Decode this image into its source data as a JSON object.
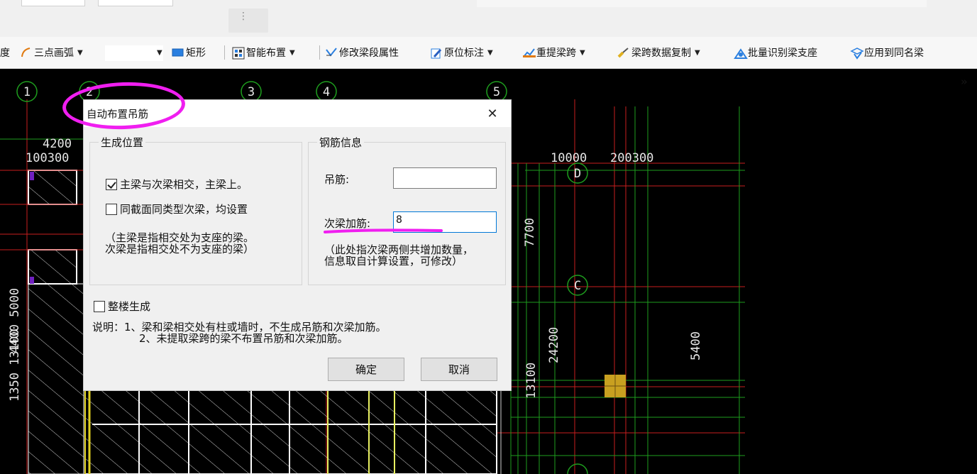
{
  "toolbar": {
    "cut_left_label": "度",
    "arc_label": "三点画弧",
    "rect_label": "矩形",
    "smart_place_label": "智能布置",
    "modify_span_label": "修改梁段属性",
    "inplace_label": "原位标注",
    "reextract_label": "重提梁跨",
    "copy_span_label": "梁跨数据复制",
    "batch_identify_label": "批量识别梁支座",
    "apply_same_label": "应用到同名梁",
    "more_label": "»"
  },
  "cad": {
    "axis_top": [
      "1",
      "2",
      "3",
      "4",
      "5"
    ],
    "axis_side": [
      "D",
      "C"
    ],
    "dims": {
      "d4200": "4200",
      "d100300": "100300",
      "d10000": "10000",
      "d200300": "200300",
      "d7700": "7700",
      "d24200": "24200",
      "d5400": "5400",
      "d13100": "13100",
      "dleft": "4400 5000",
      "dleft2": "1350 13100"
    }
  },
  "dialog": {
    "title": "自动布置吊筋",
    "position_group": {
      "title": "生成位置",
      "option1": "主梁与次梁相交，主梁上。",
      "option1_checked": true,
      "option2": "同截面同类型次梁，均设置",
      "option2_checked": false,
      "note_line1": "（主梁是指相交处为支座的梁。",
      "note_line2": "次梁是指相交处不为支座的梁）"
    },
    "rebar_group": {
      "title": "钢筋信息",
      "hanger_label": "吊筋:",
      "hanger_value": "",
      "secondary_label": "次梁加筋:",
      "secondary_value": "8",
      "note_line1": "（此处指次梁两侧共增加数量，",
      "note_line2": "信息取自计算设置，可修改）"
    },
    "whole_building_label": "整楼生成",
    "whole_building_checked": false,
    "explain_line1": "说明：1、梁和梁相交处有柱或墙时，不生成吊筋和次梁加筋。",
    "explain_line2": "2、未提取梁跨的梁不布置吊筋和次梁加筋。",
    "ok_label": "确定",
    "cancel_label": "取消"
  },
  "colors": {
    "annotation": "#f01ef0",
    "cad_bg": "#000000",
    "axis_red": "#c81e1e",
    "grid_green": "#1e9e1e",
    "beam_white": "#ffffff",
    "beam_yellow": "#e0d020"
  }
}
